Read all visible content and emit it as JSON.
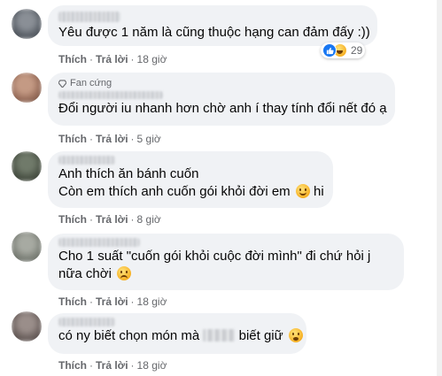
{
  "comments": [
    {
      "text": "Yêu được 1 năm là cũng thuộc hạng can đảm đấy :))",
      "like_label": "Thích",
      "reply_label": "Trả lời",
      "time": "18 giờ",
      "reactions": {
        "icons": [
          "like-icon",
          "haha-icon"
        ],
        "count": "29"
      }
    },
    {
      "badge": "Fan cứng",
      "text": "Đổi người iu nhanh hơn chờ anh í thay tính đổi nết đó ạ",
      "like_label": "Thích",
      "reply_label": "Trả lời",
      "time": "5 giờ"
    },
    {
      "line1": "Anh thích ăn bánh cuốn",
      "line2": "Còn em thích anh cuốn gói khỏi đời em",
      "line2_suffix": "hi",
      "like_label": "Thích",
      "reply_label": "Trả lời",
      "time": "8 giờ"
    },
    {
      "line1": "Cho 1 suất \"cuốn gói khỏi cuộc đời mình\" đi chứ hỏi j",
      "line2": "nữa chời",
      "like_label": "Thích",
      "reply_label": "Trả lời",
      "time": "18 giờ"
    },
    {
      "text_before": "có ny biết chọn món mà",
      "text_after": "biết giữ",
      "like_label": "Thích",
      "reply_label": "Trả lời",
      "time": "18 giờ"
    }
  ],
  "separator": "·",
  "colors": {
    "bubble": "#f0f2f5",
    "meta_text": "#65676b",
    "like_blue": "#1877f2"
  }
}
